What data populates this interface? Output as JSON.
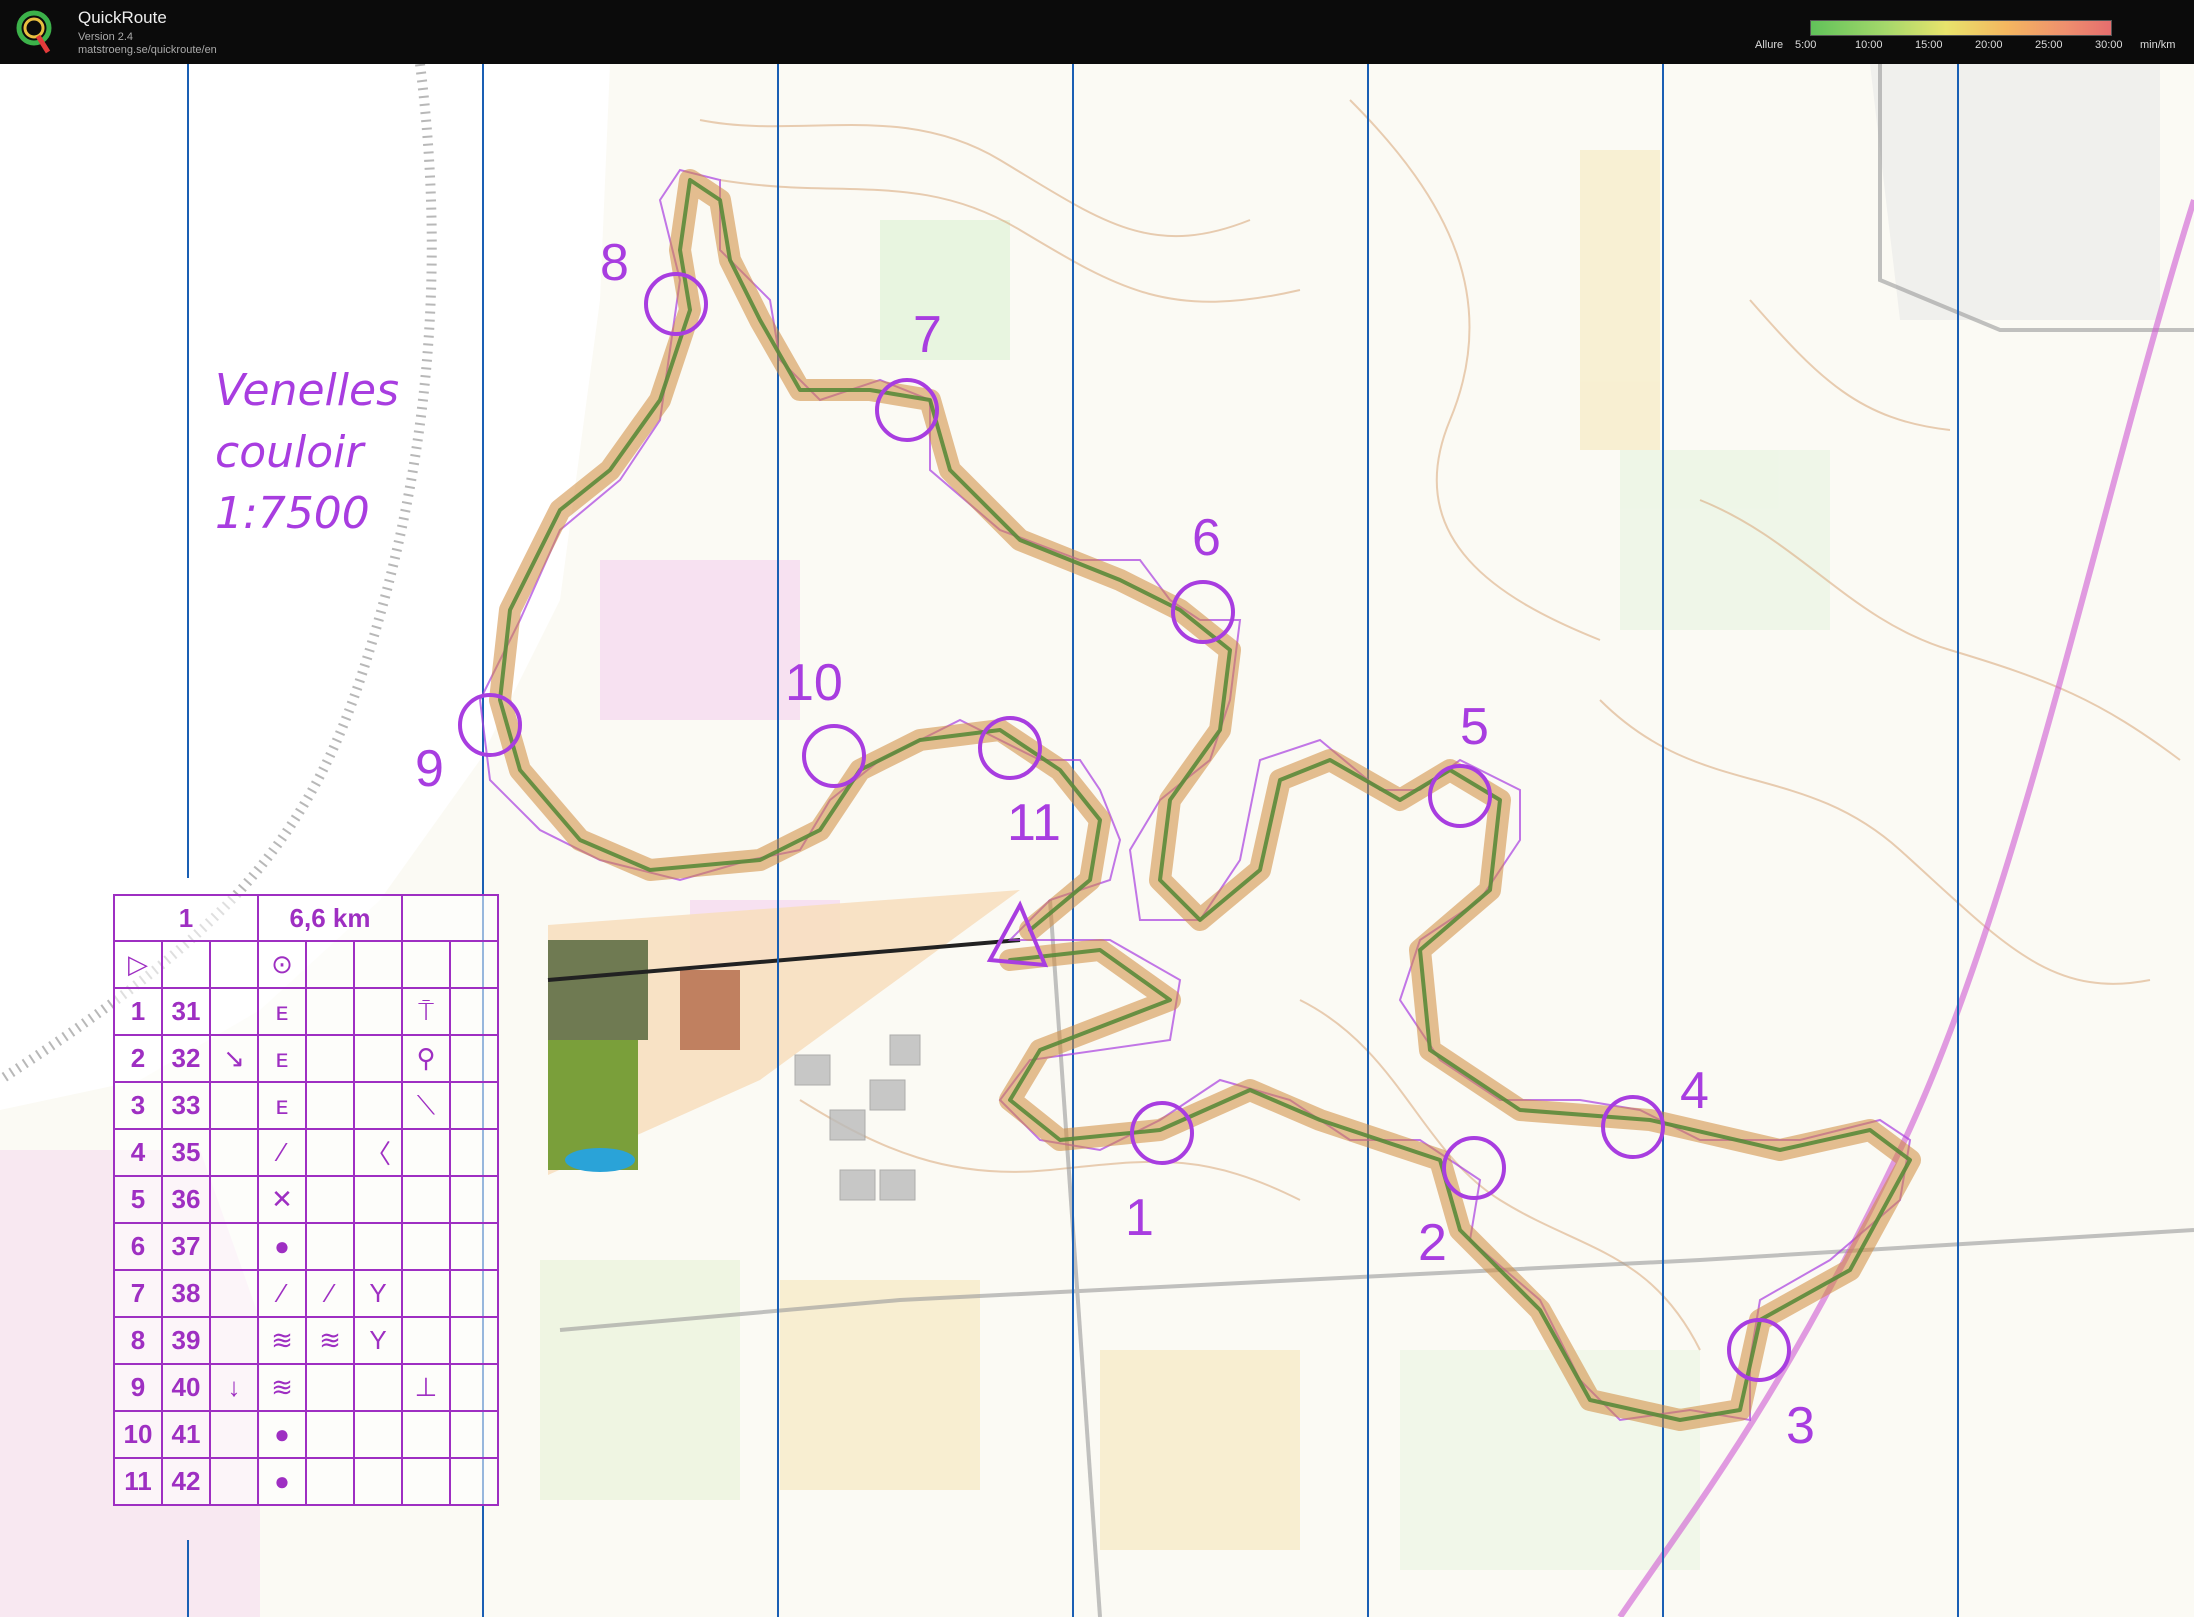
{
  "app": {
    "title": "QuickRoute",
    "version": "Version 2.4",
    "url": "matstroeng.se/quickroute/en"
  },
  "legend": {
    "label": "Allure",
    "ticks": [
      "5:00",
      "10:00",
      "15:00",
      "20:00",
      "25:00",
      "30:00"
    ],
    "unit": "min/km"
  },
  "map_title": {
    "line1": "Venelles",
    "line2": "couloir",
    "line3": "1:7500"
  },
  "controls": {
    "labels": [
      "1",
      "2",
      "3",
      "4",
      "5",
      "6",
      "7",
      "8",
      "9",
      "10",
      "11"
    ]
  },
  "control_table": {
    "course": "1",
    "length": "6,6 km",
    "rows": [
      {
        "num": "1",
        "code": "31"
      },
      {
        "num": "2",
        "code": "32"
      },
      {
        "num": "3",
        "code": "33"
      },
      {
        "num": "4",
        "code": "35"
      },
      {
        "num": "5",
        "code": "36"
      },
      {
        "num": "6",
        "code": "37"
      },
      {
        "num": "7",
        "code": "38"
      },
      {
        "num": "8",
        "code": "39"
      },
      {
        "num": "9",
        "code": "40"
      },
      {
        "num": "10",
        "code": "41"
      },
      {
        "num": "11",
        "code": "42"
      }
    ]
  },
  "colors": {
    "course": "#a83de0",
    "grid": "#1a5fb4",
    "route": "#d08a3c"
  }
}
